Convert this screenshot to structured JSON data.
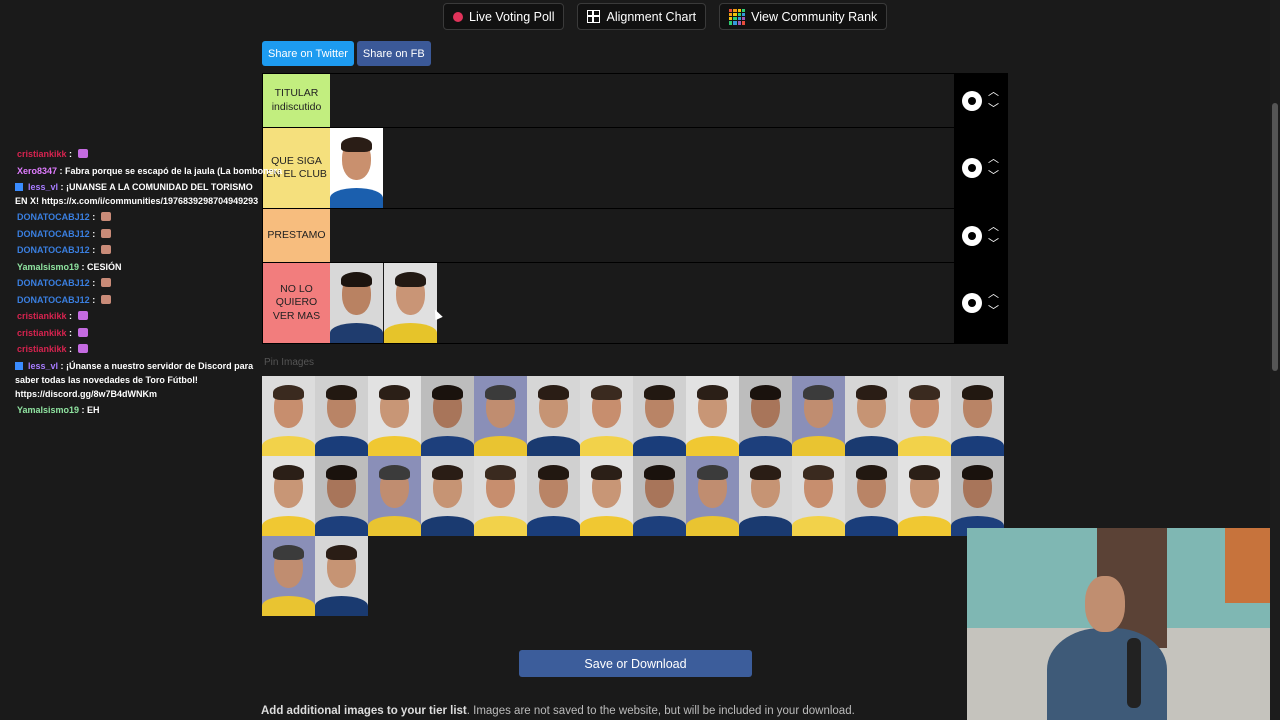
{
  "top_buttons": [
    {
      "label": "Live Voting Poll",
      "icon": "record-dot-icon"
    },
    {
      "label": "Alignment Chart",
      "icon": "grid-icon"
    },
    {
      "label": "View Community Rank",
      "icon": "rank-grid-icon"
    }
  ],
  "share": {
    "twitter": "Share on Twitter",
    "facebook": "Share on FB"
  },
  "tiers": [
    {
      "label": "TITULAR indiscutido",
      "color": "#c2ee7f"
    },
    {
      "label": "QUE SIGA EN EL CLUB",
      "color": "#f5e07d"
    },
    {
      "label": "PRESTAMO",
      "color": "#f7bd7e"
    },
    {
      "label": "NO LO QUIERO VER MAS",
      "color": "#f27d7d"
    }
  ],
  "pool_label": "Pin Images",
  "save_label": "Save or Download",
  "footnote": {
    "bold": "Add additional images to your tier list",
    "rest": ". Images are not saved to the website, but will be included in your download."
  },
  "chat": [
    {
      "user": "cristiankikk",
      "color": "#d6234f",
      "text": ": "
    },
    {
      "user": "Xero8347",
      "color": "#e07cff",
      "text": ": Fabra porque se escapó de la jaula (La bombonera"
    },
    {
      "user": "less_vl",
      "color": "#a77cff",
      "badge": true,
      "text": ": ¡UNANSE A LA COMUNIDAD DEL TORISMO EN X! https://x.com/i/communities/1976839298704949293"
    },
    {
      "user": "DONATOCABJ12",
      "color": "#3a7fe0",
      "text": ": "
    },
    {
      "user": "DONATOCABJ12",
      "color": "#3a7fe0",
      "text": ": "
    },
    {
      "user": "DONATOCABJ12",
      "color": "#3a7fe0",
      "text": ": "
    },
    {
      "user": "Yamalsismo19",
      "color": "#8fe3a0",
      "text": ": CESIÓN"
    },
    {
      "user": "DONATOCABJ12",
      "color": "#3a7fe0",
      "text": ": "
    },
    {
      "user": "DONATOCABJ12",
      "color": "#3a7fe0",
      "text": ": "
    },
    {
      "user": "cristiankikk",
      "color": "#d6234f",
      "text": ": "
    },
    {
      "user": "cristiankikk",
      "color": "#d6234f",
      "text": ": "
    },
    {
      "user": "cristiankikk",
      "color": "#d6234f",
      "text": ": "
    },
    {
      "user": "less_vl",
      "color": "#a77cff",
      "badge": true,
      "text": ": ¡Únanse a nuestro servidor de Discord para saber todas las novedades de Toro Fútbol! https://discord.gg/8w7B4dWNKm"
    },
    {
      "user": "Yamalsismo19",
      "color": "#8fe3a0",
      "text": ": EH"
    }
  ]
}
